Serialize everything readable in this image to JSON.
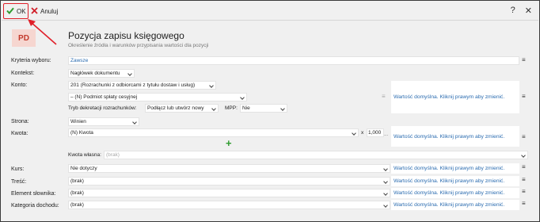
{
  "toolbar": {
    "ok_label": "OK",
    "cancel_label": "Anuluj",
    "help_label": "?",
    "close_label": "✕"
  },
  "header": {
    "logo": "PD",
    "title": "Pozycja zapisu księgowego",
    "subtitle": "Określenie źródła i warunków przypisania wartości dla pozycji"
  },
  "labels": {
    "kryteria": "Kryteria wyboru:",
    "kontekst": "Kontekst:",
    "konto": "Konto:",
    "tryb": "Tryb dekretacji rozrachunków:",
    "mpp": "MPP:",
    "strona": "Strona:",
    "kwota": "Kwota:",
    "kwota_wlasna": "Kwota własna:",
    "kurs": "Kurs:",
    "tresc": "Treść:",
    "element": "Element słownika:",
    "kategoria": "Kategoria dochodu:"
  },
  "values": {
    "kryteria": "Zawsze",
    "kontekst": "Nagłówek dokumentu",
    "konto1": "201 (Rozrachunki z odbiorcami z tytułu dostaw i usług)",
    "konto2": "– (N) Podmiot spłaty cesyjnej",
    "tryb": "Podłącz lub utwórz nowy",
    "mpp": "Nie",
    "strona": "Winien",
    "kwota": "(N) Kwota",
    "kwota_x": "x",
    "kwota_mult": "1,000",
    "kwota_dots": "...",
    "kwota_wlasna": "(brak)",
    "kurs": "Nie dotyczy",
    "tresc": "(brak)",
    "element": "(brak)",
    "kategoria": "(brak)"
  },
  "default_text": "Wartość domyślna. Kliknij prawym aby zmienić.",
  "menu_glyph": "≡",
  "add_glyph": "+",
  "colors": {
    "ok_border": "#e0202a",
    "ok_check": "#2e9b2e",
    "cancel_x": "#d0202a",
    "link": "#2b6cb0",
    "logo_bg": "#f6d6d0",
    "logo_text": "#c3392b"
  }
}
